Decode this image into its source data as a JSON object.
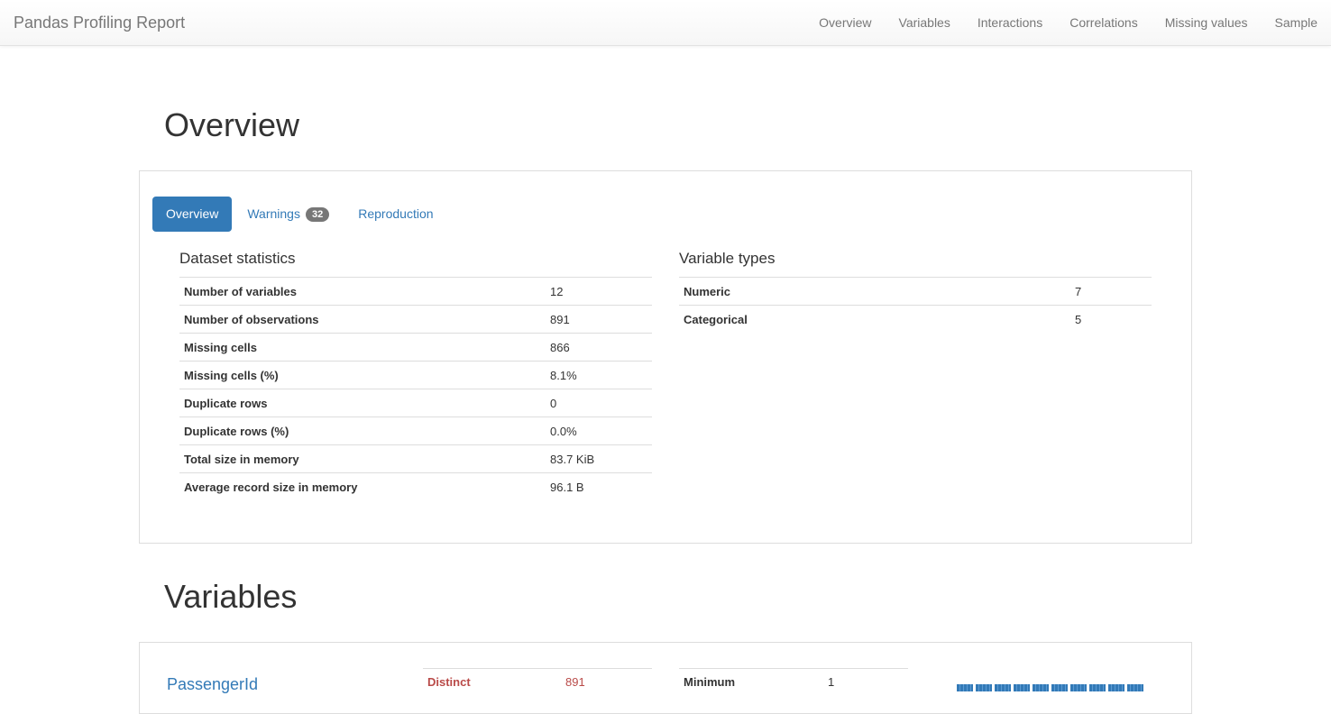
{
  "nav": {
    "brand": "Pandas Profiling Report",
    "links": [
      "Overview",
      "Variables",
      "Interactions",
      "Correlations",
      "Missing values",
      "Sample"
    ]
  },
  "overview": {
    "heading": "Overview",
    "tabs": {
      "overview": "Overview",
      "warnings": "Warnings",
      "warnings_count": "32",
      "reproduction": "Reproduction"
    },
    "dataset_statistics": {
      "title": "Dataset statistics",
      "rows": [
        {
          "k": "Number of variables",
          "v": "12"
        },
        {
          "k": "Number of observations",
          "v": "891"
        },
        {
          "k": "Missing cells",
          "v": "866"
        },
        {
          "k": "Missing cells (%)",
          "v": "8.1%"
        },
        {
          "k": "Duplicate rows",
          "v": "0"
        },
        {
          "k": "Duplicate rows (%)",
          "v": "0.0%"
        },
        {
          "k": "Total size in memory",
          "v": "83.7 KiB"
        },
        {
          "k": "Average record size in memory",
          "v": "96.1 B"
        }
      ]
    },
    "variable_types": {
      "title": "Variable types",
      "rows": [
        {
          "k": "Numeric",
          "v": "7"
        },
        {
          "k": "Categorical",
          "v": "5"
        }
      ]
    }
  },
  "variables": {
    "heading": "Variables",
    "first": {
      "name": "PassengerId",
      "distinct_label": "Distinct",
      "distinct_value": "891",
      "minimum_label": "Minimum",
      "minimum_value": "1"
    }
  }
}
